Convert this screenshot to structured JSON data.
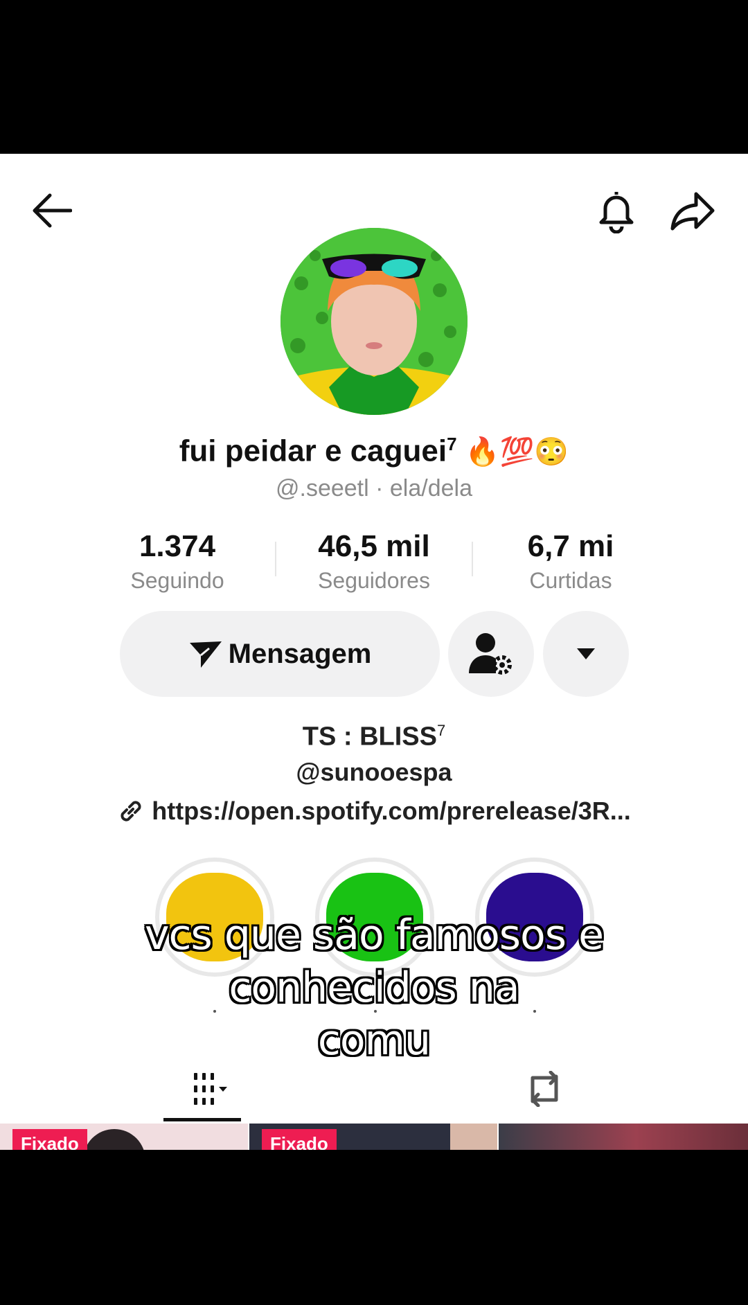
{
  "header": {
    "back": "back-arrow-icon",
    "bell": "bell-icon",
    "share": "share-icon"
  },
  "profile": {
    "display_name": "fui peidar e caguei",
    "display_name_sup": "7",
    "emojis": "🔥💯😳",
    "handle_line": "@.seeetl · ela/dela"
  },
  "stats": [
    {
      "value": "1.374",
      "label": "Seguindo"
    },
    {
      "value": "46,5 mil",
      "label": "Seguidores"
    },
    {
      "value": "6,7 mi",
      "label": "Curtidas"
    }
  ],
  "actions": {
    "message_label": "Mensagem"
  },
  "bio": {
    "line1": "TS : BLISS",
    "line1_sup": "7",
    "line2": "@sunooespa",
    "link": "https://open.spotify.com/prerelease/3R..."
  },
  "highlights": [
    {
      "color": "#f2c40f"
    },
    {
      "color": "#19c214"
    },
    {
      "color": "#2a0d8f"
    }
  ],
  "caption": {
    "line1": "vcs que são famosos e",
    "line2": "conhecidos na",
    "line3": "comu"
  },
  "tabs": {
    "videos": "grid-icon",
    "reposts": "repost-icon"
  },
  "thumbnails": [
    {
      "pin_label": "Fixado"
    },
    {
      "pin_label": "Fixado"
    }
  ]
}
